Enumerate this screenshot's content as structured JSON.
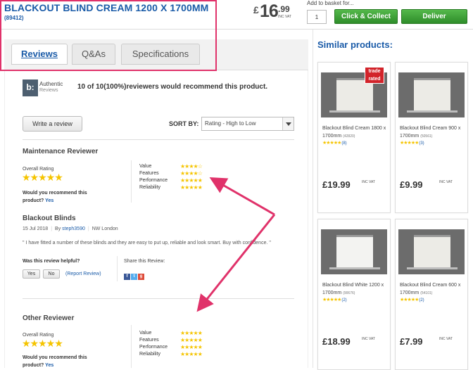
{
  "header": {
    "title": "BLACKOUT BLIND CREAM 1200 X 1700MM",
    "code": "(89412)",
    "price_currency": "£",
    "price_main": "16",
    "price_pence": ".99",
    "price_vat": "INC VAT",
    "add_to_basket_label": "Add to basket for...",
    "qty_value": "1",
    "click_collect_label": "Click & Collect",
    "deliver_label": "Deliver"
  },
  "tabs": [
    {
      "label": "Reviews",
      "active": true
    },
    {
      "label": "Q&As",
      "active": false
    },
    {
      "label": "Specifications",
      "active": false
    }
  ],
  "authentic": {
    "logo_text": "b:",
    "line1": "Authentic",
    "line2": "Reviews",
    "recommend_text": "10 of 10(100%)reviewers would recommend this product."
  },
  "controls": {
    "write_review": "Write a review",
    "sort_label": "SORT BY:",
    "sort_value": "Rating - High to Low"
  },
  "review_common": {
    "overall_rating_label": "Overall Rating",
    "recommend_question": "Would you recommend this product?",
    "yes": "Yes",
    "rating_labels": [
      "Value",
      "Features",
      "Performance",
      "Reliability"
    ]
  },
  "review1": {
    "reviewer": "Maintenance Reviewer",
    "overall_stars": "★★★★★",
    "sub_stars": [
      "★★★★☆",
      "★★★★☆",
      "★★★★★",
      "★★★★★"
    ],
    "title": "Blackout Blinds",
    "date": "15 Jul 2018",
    "by_label": "By",
    "author": "steph3590",
    "location": "NW London",
    "text": "\" I have fitted a number of these blinds and they are easy to put up, reliable and look smart. Buy with confidence. \"",
    "helpful_label": "Was this review helpful?",
    "yes_btn": "Yes",
    "no_btn": "No",
    "report": "(Report Review)",
    "share_label": "Share this Review:"
  },
  "review2": {
    "reviewer": "Other Reviewer",
    "overall_stars": "★★★★★",
    "sub_stars": [
      "★★★★★",
      "★★★★★",
      "★★★★★",
      "★★★★★"
    ]
  },
  "similar": {
    "title": "Similar products:",
    "badge": "trade rated",
    "products": [
      {
        "name": "Blackout Blind Cream 1800 x 1700mm",
        "code": "(42820)",
        "stars": "★★★★★",
        "count": "(8)",
        "price": "£19.99",
        "vat": "INC VAT"
      },
      {
        "name": "Blackout Blind Cream 900 x 1700mm",
        "code": "(50561)",
        "stars": "★★★★★",
        "count": "(3)",
        "price": "£9.99",
        "vat": "INC VAT"
      },
      {
        "name": "Blackout Blind White 1200 x 1700mm",
        "code": "(90676)",
        "stars": "★★★★★",
        "count": "(2)",
        "price": "£18.99",
        "vat": "INC VAT"
      },
      {
        "name": "Blackout Blind Cream 600 x 1700mm",
        "code": "(54101)",
        "stars": "★★★★★",
        "count": "(2)",
        "price": "£7.99",
        "vat": "INC VAT"
      }
    ]
  },
  "colors": {
    "accent_blue": "#1a5ba8",
    "button_green": "#3a9c33",
    "highlight_pink": "#e0326a",
    "star_yellow": "#f5c400"
  }
}
